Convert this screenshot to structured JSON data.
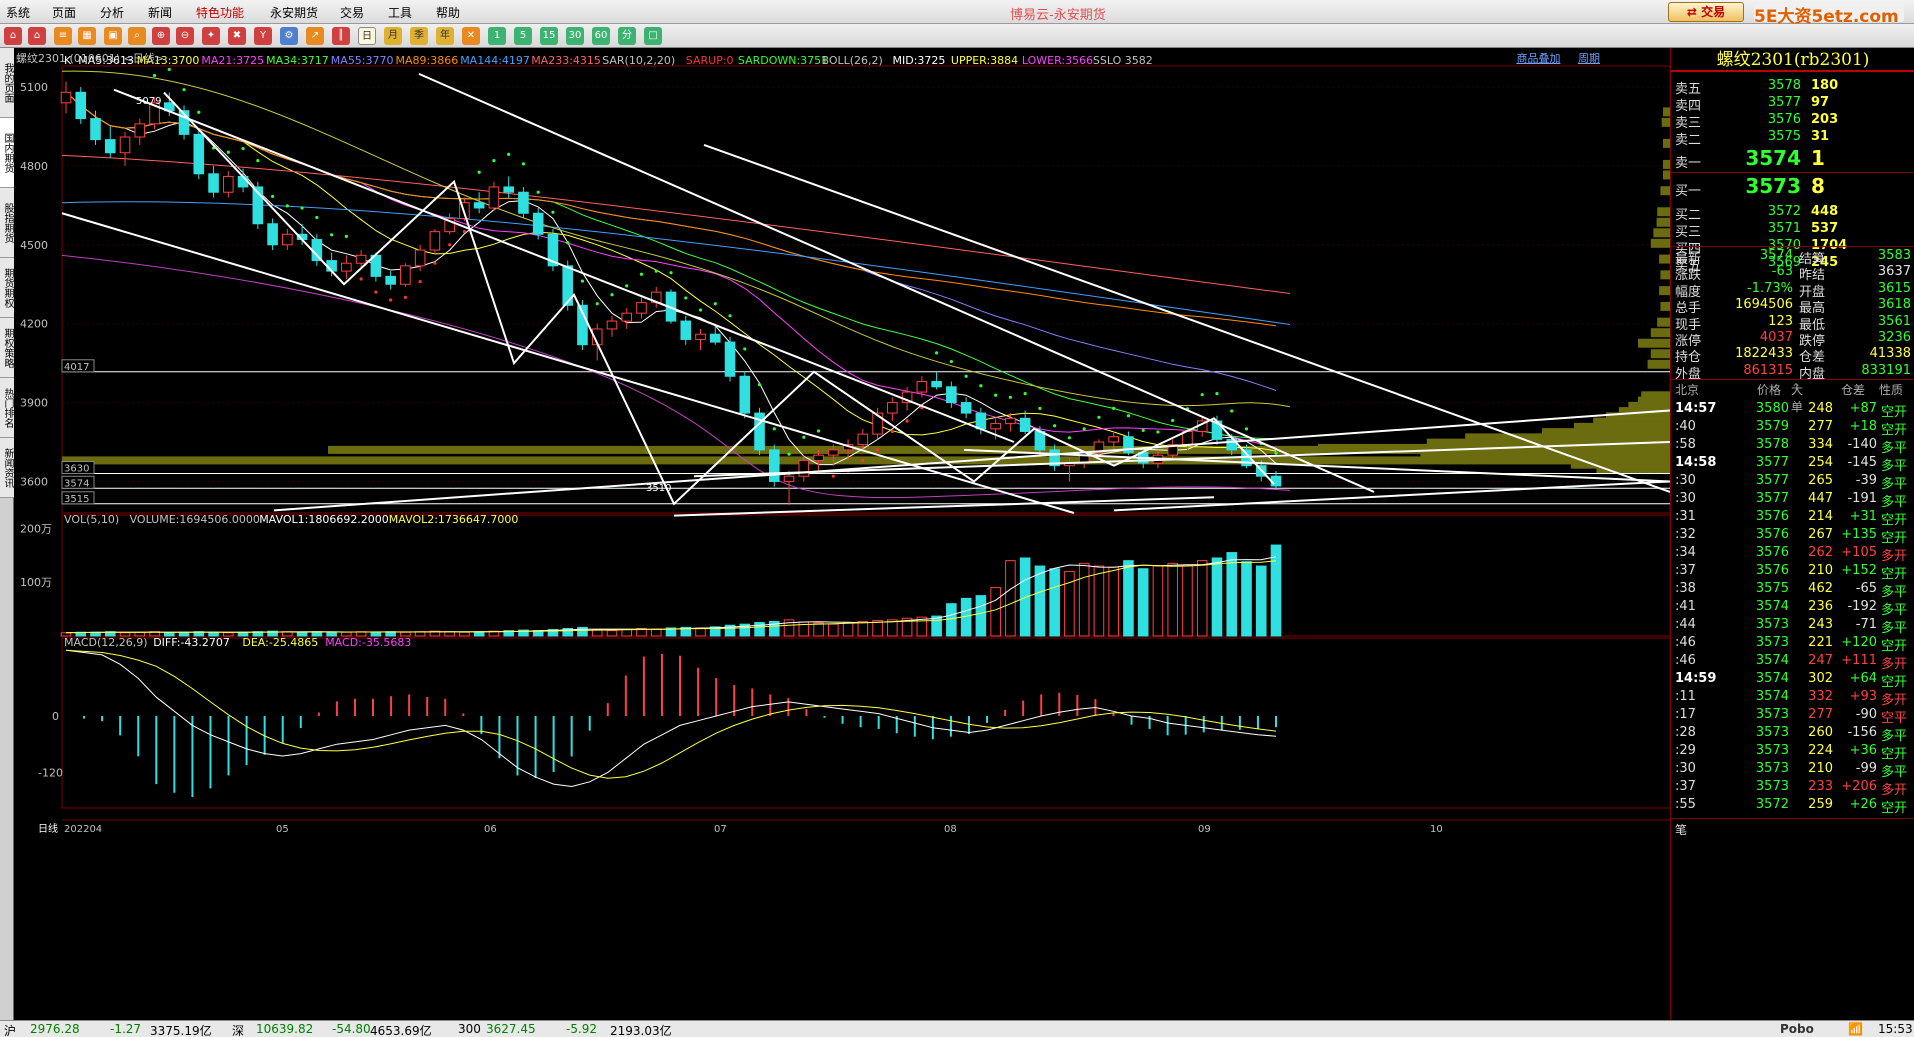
{
  "menubar": {
    "items": [
      "系统",
      "页面",
      "分析",
      "新闻",
      "特色功能",
      "永安期货",
      "交易",
      "工具",
      "帮助"
    ],
    "title": "博易云-永安期货",
    "trade_label": "交易",
    "logo": "5E大资5etz.com"
  },
  "toolbar": {
    "icons": [
      "home-icon",
      "back-icon",
      "list-icon",
      "grid-icon",
      "search-icon",
      "zoom-in-icon",
      "zoom-out-icon",
      "pin-icon",
      "tools-icon",
      "cup-icon",
      "indicator-icon",
      "chart-icon",
      "kline-icon"
    ],
    "period_buttons": [
      "日",
      "月",
      "季",
      "年",
      "1",
      "5",
      "15",
      "30",
      "60",
      "分"
    ]
  },
  "left_tabs": [
    "我的页面",
    "国内期货",
    "股指期货",
    "期货期权",
    "期权策略",
    "热门排名",
    "新闻资讯"
  ],
  "chart": {
    "title": "螺纹2301 (010601) <日线>",
    "links": [
      "商品叠加",
      "周期"
    ],
    "ma_legend": [
      {
        "text": "K",
        "color": "#ffffff"
      },
      {
        "text": "MA5:3613",
        "color": "#ffffff"
      },
      {
        "text": "MA13:3700",
        "color": "#ffff40"
      },
      {
        "text": "MA21:3725",
        "color": "#ff40ff"
      },
      {
        "text": "MA34:3717",
        "color": "#40ff40"
      },
      {
        "text": "MA55:3770",
        "color": "#8080ff"
      },
      {
        "text": "MA89:3866",
        "color": "#ff8c00"
      },
      {
        "text": "MA144:4197",
        "color": "#40a0ff"
      },
      {
        "text": "MA233:4315",
        "color": "#ff6060"
      },
      {
        "text": "SAR(10,2,20)",
        "color": "#c0c0c0"
      },
      {
        "text": "SARUP:0",
        "color": "#ff3030"
      },
      {
        "text": "SARDOWN:3751",
        "color": "#30ff30"
      },
      {
        "text": "BOLL(26,2)",
        "color": "#c0c0c0"
      },
      {
        "text": "MID:3725",
        "color": "#ffffff"
      },
      {
        "text": "UPPER:3884",
        "color": "#ffff40"
      },
      {
        "text": "LOWER:3566",
        "color": "#ff40ff"
      },
      {
        "text": "SSLO 3582",
        "color": "#c0c0c0"
      }
    ],
    "price_ticks": [
      "5100",
      "4800",
      "4500",
      "4200",
      "3900",
      "3600"
    ],
    "price_tick_values": [
      5100,
      4800,
      4500,
      4200,
      3900,
      3600
    ],
    "hlines": [
      {
        "label": "4017",
        "value": 4017
      },
      {
        "label": "3630",
        "value": 3630
      },
      {
        "label": "3574",
        "value": 3574
      },
      {
        "label": "3515",
        "value": 3515
      }
    ],
    "high_label": "5079",
    "low_label": "3510",
    "vol_legend": [
      {
        "text": "VOL(5,10)",
        "color": "#c0c0c0"
      },
      {
        "text": "VOLUME:1694506.0000",
        "color": "#c0c0c0"
      },
      {
        "text": "MAVOL1:1806692.2000",
        "color": "#ffffff"
      },
      {
        "text": "MAVOL2:1736647.7000",
        "color": "#ffff40"
      }
    ],
    "vol_ticks": [
      "200万",
      "100万"
    ],
    "macd_legend": [
      {
        "text": "MACD(12,26,9)",
        "color": "#c0c0c0"
      },
      {
        "text": "DIFF:-43.2707",
        "color": "#ffffff"
      },
      {
        "text": "DEA:-25.4865",
        "color": "#ffff40"
      },
      {
        "text": "MACD:-35.5683",
        "color": "#ff40ff"
      }
    ],
    "macd_ticks": [
      "0",
      "-120"
    ],
    "x_labels": [
      "日线",
      "202204",
      "05",
      "06",
      "07",
      "08",
      "09",
      "10"
    ]
  },
  "chart_data": {
    "type": "candlestick",
    "symbol": "螺纹2301",
    "period": "日线",
    "ylim": [
      3480,
      5180
    ],
    "ohlc_approx": [
      [
        5040,
        5120,
        5000,
        5080
      ],
      [
        5080,
        5100,
        4960,
        4980
      ],
      [
        4980,
        5010,
        4880,
        4900
      ],
      [
        4900,
        4950,
        4830,
        4850
      ],
      [
        4850,
        4930,
        4800,
        4910
      ],
      [
        4910,
        4980,
        4880,
        4960
      ],
      [
        4960,
        5060,
        4940,
        5040
      ],
      [
        5040,
        5079,
        4990,
        5010
      ],
      [
        5010,
        5030,
        4900,
        4920
      ],
      [
        4920,
        4940,
        4750,
        4770
      ],
      [
        4770,
        4800,
        4680,
        4700
      ],
      [
        4700,
        4780,
        4680,
        4760
      ],
      [
        4760,
        4790,
        4700,
        4720
      ],
      [
        4720,
        4740,
        4560,
        4580
      ],
      [
        4580,
        4600,
        4480,
        4500
      ],
      [
        4500,
        4560,
        4480,
        4540
      ],
      [
        4540,
        4580,
        4500,
        4520
      ],
      [
        4520,
        4540,
        4420,
        4440
      ],
      [
        4440,
        4470,
        4380,
        4400
      ],
      [
        4400,
        4460,
        4370,
        4430
      ],
      [
        4430,
        4480,
        4410,
        4460
      ],
      [
        4460,
        4470,
        4360,
        4380
      ],
      [
        4380,
        4400,
        4330,
        4350
      ],
      [
        4350,
        4430,
        4340,
        4420
      ],
      [
        4420,
        4500,
        4400,
        4480
      ],
      [
        4480,
        4560,
        4470,
        4550
      ],
      [
        4550,
        4620,
        4540,
        4600
      ],
      [
        4600,
        4680,
        4590,
        4660
      ],
      [
        4660,
        4700,
        4620,
        4640
      ],
      [
        4640,
        4740,
        4630,
        4720
      ],
      [
        4720,
        4760,
        4680,
        4700
      ],
      [
        4700,
        4720,
        4600,
        4620
      ],
      [
        4620,
        4640,
        4520,
        4540
      ],
      [
        4540,
        4560,
        4400,
        4420
      ],
      [
        4420,
        4440,
        4250,
        4270
      ],
      [
        4270,
        4290,
        4100,
        4120
      ],
      [
        4120,
        4200,
        4060,
        4180
      ],
      [
        4180,
        4230,
        4150,
        4210
      ],
      [
        4210,
        4260,
        4180,
        4240
      ],
      [
        4240,
        4300,
        4220,
        4280
      ],
      [
        4280,
        4340,
        4260,
        4320
      ],
      [
        4320,
        4330,
        4200,
        4210
      ],
      [
        4210,
        4230,
        4120,
        4140
      ],
      [
        4140,
        4180,
        4100,
        4160
      ],
      [
        4160,
        4200,
        4120,
        4130
      ],
      [
        4130,
        4150,
        3980,
        4000
      ],
      [
        4000,
        4020,
        3840,
        3860
      ],
      [
        3860,
        3880,
        3700,
        3720
      ],
      [
        3720,
        3740,
        3580,
        3600
      ],
      [
        3600,
        3640,
        3510,
        3620
      ],
      [
        3620,
        3700,
        3600,
        3680
      ],
      [
        3680,
        3720,
        3640,
        3700
      ],
      [
        3700,
        3740,
        3660,
        3720
      ],
      [
        3720,
        3760,
        3680,
        3740
      ],
      [
        3740,
        3800,
        3720,
        3780
      ],
      [
        3780,
        3880,
        3760,
        3860
      ],
      [
        3860,
        3920,
        3830,
        3900
      ],
      [
        3900,
        3960,
        3870,
        3940
      ],
      [
        3940,
        4000,
        3920,
        3980
      ],
      [
        3980,
        4017,
        3950,
        3960
      ],
      [
        3960,
        3980,
        3880,
        3900
      ],
      [
        3900,
        3920,
        3840,
        3860
      ],
      [
        3860,
        3880,
        3780,
        3800
      ],
      [
        3800,
        3840,
        3760,
        3820
      ],
      [
        3820,
        3860,
        3790,
        3840
      ],
      [
        3840,
        3870,
        3780,
        3790
      ],
      [
        3790,
        3810,
        3700,
        3720
      ],
      [
        3720,
        3740,
        3640,
        3660
      ],
      [
        3660,
        3690,
        3600,
        3670
      ],
      [
        3670,
        3720,
        3650,
        3710
      ],
      [
        3710,
        3760,
        3690,
        3750
      ],
      [
        3750,
        3790,
        3720,
        3770
      ],
      [
        3770,
        3790,
        3700,
        3710
      ],
      [
        3710,
        3730,
        3650,
        3670
      ],
      [
        3670,
        3720,
        3650,
        3700
      ],
      [
        3700,
        3760,
        3680,
        3740
      ],
      [
        3740,
        3800,
        3720,
        3790
      ],
      [
        3790,
        3850,
        3770,
        3830
      ],
      [
        3830,
        3850,
        3740,
        3760
      ],
      [
        3760,
        3780,
        3700,
        3720
      ],
      [
        3720,
        3740,
        3650,
        3660
      ],
      [
        3660,
        3680,
        3600,
        3620
      ],
      [
        3620,
        3640,
        3570,
        3583
      ]
    ],
    "volume_approx": [
      0.06,
      0.07,
      0.07,
      0.08,
      0.06,
      0.07,
      0.08,
      0.06,
      0.07,
      0.08,
      0.07,
      0.06,
      0.07,
      0.08,
      0.09,
      0.08,
      0.07,
      0.08,
      0.07,
      0.07,
      0.08,
      0.07,
      0.08,
      0.07,
      0.08,
      0.09,
      0.08,
      0.07,
      0.08,
      0.09,
      0.1,
      0.11,
      0.1,
      0.12,
      0.14,
      0.16,
      0.12,
      0.1,
      0.12,
      0.14,
      0.13,
      0.15,
      0.16,
      0.15,
      0.17,
      0.2,
      0.22,
      0.25,
      0.27,
      0.3,
      0.26,
      0.24,
      0.22,
      0.25,
      0.27,
      0.29,
      0.3,
      0.33,
      0.35,
      0.37,
      0.6,
      0.7,
      0.75,
      0.9,
      1.4,
      1.45,
      1.3,
      1.25,
      1.2,
      1.35,
      1.3,
      1.28,
      1.4,
      1.25,
      1.3,
      1.35,
      1.32,
      1.4,
      1.45,
      1.55,
      1.38,
      1.3,
      1.69
    ],
    "macd_diff_approx": [
      140,
      135,
      130,
      110,
      80,
      40,
      10,
      -20,
      -40,
      -55,
      -70,
      -80,
      -85,
      -80,
      -70,
      -60,
      -55,
      -50,
      -40,
      -30,
      -25,
      -20,
      -30,
      -50,
      -80,
      -110,
      -130,
      -145,
      -150,
      -140,
      -120,
      -90,
      -60,
      -40,
      -20,
      -10,
      0,
      10,
      20,
      25,
      30,
      25,
      20,
      15,
      10,
      5,
      -5,
      -15,
      -25,
      -30,
      -35,
      -30,
      -20,
      -10,
      0,
      8,
      14,
      18,
      10,
      0,
      -5,
      -15,
      -20,
      -25,
      -30,
      -35,
      -40,
      -43
    ]
  },
  "right_panel": {
    "contract": "螺纹2301(rb2301)",
    "asks": [
      {
        "label": "卖五",
        "price": "3578",
        "vol": "180"
      },
      {
        "label": "卖四",
        "price": "3577",
        "vol": "97"
      },
      {
        "label": "卖三",
        "price": "3576",
        "vol": "203"
      },
      {
        "label": "卖二",
        "price": "3575",
        "vol": "31"
      }
    ],
    "ask1": {
      "label": "卖一",
      "price": "3574",
      "vol": "1"
    },
    "bid1": {
      "label": "买一",
      "price": "3573",
      "vol": "8"
    },
    "bids": [
      {
        "label": "买二",
        "price": "3572",
        "vol": "448"
      },
      {
        "label": "买三",
        "price": "3571",
        "vol": "537"
      },
      {
        "label": "买四",
        "price": "3570",
        "vol": "1704"
      },
      {
        "label": "买五",
        "price": "3569",
        "vol": "245"
      }
    ],
    "quote": [
      {
        "l1": "最新",
        "v1": "3574",
        "c1": "green",
        "l2": "结算",
        "v2": "3583",
        "c2": "green"
      },
      {
        "l1": "涨跌",
        "v1": "-63",
        "c1": "green",
        "l2": "昨结",
        "v2": "3637",
        "c2": "white"
      },
      {
        "l1": "幅度",
        "v1": "-1.73%",
        "c1": "green",
        "l2": "开盘",
        "v2": "3615",
        "c2": "green"
      },
      {
        "l1": "总手",
        "v1": "1694506",
        "c1": "yellow",
        "l2": "最高",
        "v2": "3618",
        "c2": "green"
      },
      {
        "l1": "现手",
        "v1": "123",
        "c1": "yellow",
        "l2": "最低",
        "v2": "3561",
        "c2": "green"
      },
      {
        "l1": "涨停",
        "v1": "4037",
        "c1": "red",
        "l2": "跌停",
        "v2": "3236",
        "c2": "green"
      },
      {
        "l1": "持仓",
        "v1": "1822433",
        "c1": "yellow",
        "l2": "仓差",
        "v2": "41338",
        "c2": "yellow"
      },
      {
        "l1": "外盘",
        "v1": "861315",
        "c1": "red",
        "l2": "内盘",
        "v2": "833191",
        "c2": "green"
      }
    ],
    "tick_header": [
      "北京",
      "价格",
      "大单",
      "仓差",
      "性质"
    ],
    "ticks": [
      {
        "t": "14:57",
        "big": true,
        "p": "3580",
        "pc": "green",
        "v": "248",
        "oi": "+87",
        "oic": "green",
        "n": "空开",
        "nc": "green"
      },
      {
        "t": ":40",
        "p": "3579",
        "pc": "green",
        "v": "277",
        "oi": "+18",
        "oic": "green",
        "n": "空开",
        "nc": "green"
      },
      {
        "t": ":58",
        "p": "3578",
        "pc": "green",
        "v": "334",
        "oi": "-140",
        "oic": "white",
        "n": "多平",
        "nc": "green"
      },
      {
        "t": "14:58",
        "big": true,
        "p": "3577",
        "pc": "green",
        "v": "254",
        "oi": "-145",
        "oic": "white",
        "n": "多平",
        "nc": "green"
      },
      {
        "t": ":30",
        "p": "3577",
        "pc": "green",
        "v": "265",
        "oi": "-39",
        "oic": "white",
        "n": "多平",
        "nc": "green"
      },
      {
        "t": ":30",
        "p": "3577",
        "pc": "green",
        "v": "447",
        "oi": "-191",
        "oic": "white",
        "n": "多平",
        "nc": "green"
      },
      {
        "t": ":31",
        "p": "3576",
        "pc": "green",
        "v": "214",
        "oi": "+31",
        "oic": "green",
        "n": "空开",
        "nc": "green"
      },
      {
        "t": ":32",
        "p": "3576",
        "pc": "green",
        "v": "267",
        "oi": "+135",
        "oic": "green",
        "n": "空开",
        "nc": "green"
      },
      {
        "t": ":34",
        "p": "3576",
        "pc": "green",
        "v": "262",
        "vc": "red",
        "oi": "+105",
        "oic": "red",
        "n": "多开",
        "nc": "red"
      },
      {
        "t": ":37",
        "p": "3576",
        "pc": "green",
        "v": "210",
        "oi": "+152",
        "oic": "green",
        "n": "空开",
        "nc": "green"
      },
      {
        "t": ":38",
        "p": "3575",
        "pc": "green",
        "v": "462",
        "oi": "-65",
        "oic": "white",
        "n": "多平",
        "nc": "green"
      },
      {
        "t": ":41",
        "p": "3574",
        "pc": "green",
        "v": "236",
        "oi": "-192",
        "oic": "white",
        "n": "多平",
        "nc": "green"
      },
      {
        "t": ":44",
        "p": "3573",
        "pc": "green",
        "v": "243",
        "oi": "-71",
        "oic": "white",
        "n": "多平",
        "nc": "green"
      },
      {
        "t": ":46",
        "p": "3573",
        "pc": "green",
        "v": "221",
        "oi": "+120",
        "oic": "green",
        "n": "空开",
        "nc": "green"
      },
      {
        "t": ":46",
        "p": "3574",
        "pc": "green",
        "v": "247",
        "vc": "red",
        "oi": "+111",
        "oic": "red",
        "n": "多开",
        "nc": "red"
      },
      {
        "t": "14:59",
        "big": true,
        "p": "3574",
        "pc": "green",
        "v": "302",
        "oi": "+64",
        "oic": "green",
        "n": "空开",
        "nc": "green"
      },
      {
        "t": ":11",
        "p": "3574",
        "pc": "green",
        "v": "332",
        "vc": "red",
        "oi": "+93",
        "oic": "red",
        "n": "多开",
        "nc": "red"
      },
      {
        "t": ":17",
        "p": "3573",
        "pc": "green",
        "v": "277",
        "vc": "red",
        "oi": "-90",
        "oic": "white",
        "n": "空平",
        "nc": "red"
      },
      {
        "t": ":28",
        "p": "3573",
        "pc": "green",
        "v": "260",
        "oi": "-156",
        "oic": "white",
        "n": "多平",
        "nc": "green"
      },
      {
        "t": ":29",
        "p": "3573",
        "pc": "green",
        "v": "224",
        "oi": "+36",
        "oic": "green",
        "n": "空开",
        "nc": "green"
      },
      {
        "t": ":30",
        "p": "3573",
        "pc": "green",
        "v": "210",
        "oi": "-99",
        "oic": "white",
        "n": "多平",
        "nc": "green"
      },
      {
        "t": ":37",
        "p": "3573",
        "pc": "green",
        "v": "233",
        "vc": "red",
        "oi": "+206",
        "oic": "red",
        "n": "多开",
        "nc": "red"
      },
      {
        "t": ":55",
        "p": "3572",
        "pc": "green",
        "v": "259",
        "oi": "+26",
        "oic": "green",
        "n": "空开",
        "nc": "green"
      }
    ],
    "footer": "笔"
  },
  "statusbar": {
    "items": [
      {
        "text": "沪",
        "color": "#000"
      },
      {
        "text": "2976.28",
        "color": "#008000"
      },
      {
        "text": "-1.27",
        "color": "#008000"
      },
      {
        "text": "3375.19亿",
        "color": "#000"
      },
      {
        "text": "深",
        "color": "#000"
      },
      {
        "text": "10639.82",
        "color": "#008000"
      },
      {
        "text": "-54.80",
        "color": "#008000"
      },
      {
        "text": "4653.69亿",
        "color": "#000"
      },
      {
        "text": "300",
        "color": "#000"
      },
      {
        "text": "3627.45",
        "color": "#008000"
      },
      {
        "text": "-5.92",
        "color": "#008000"
      },
      {
        "text": "2193.03亿",
        "color": "#000"
      }
    ],
    "brand": "Pobo",
    "time": "15:53"
  }
}
